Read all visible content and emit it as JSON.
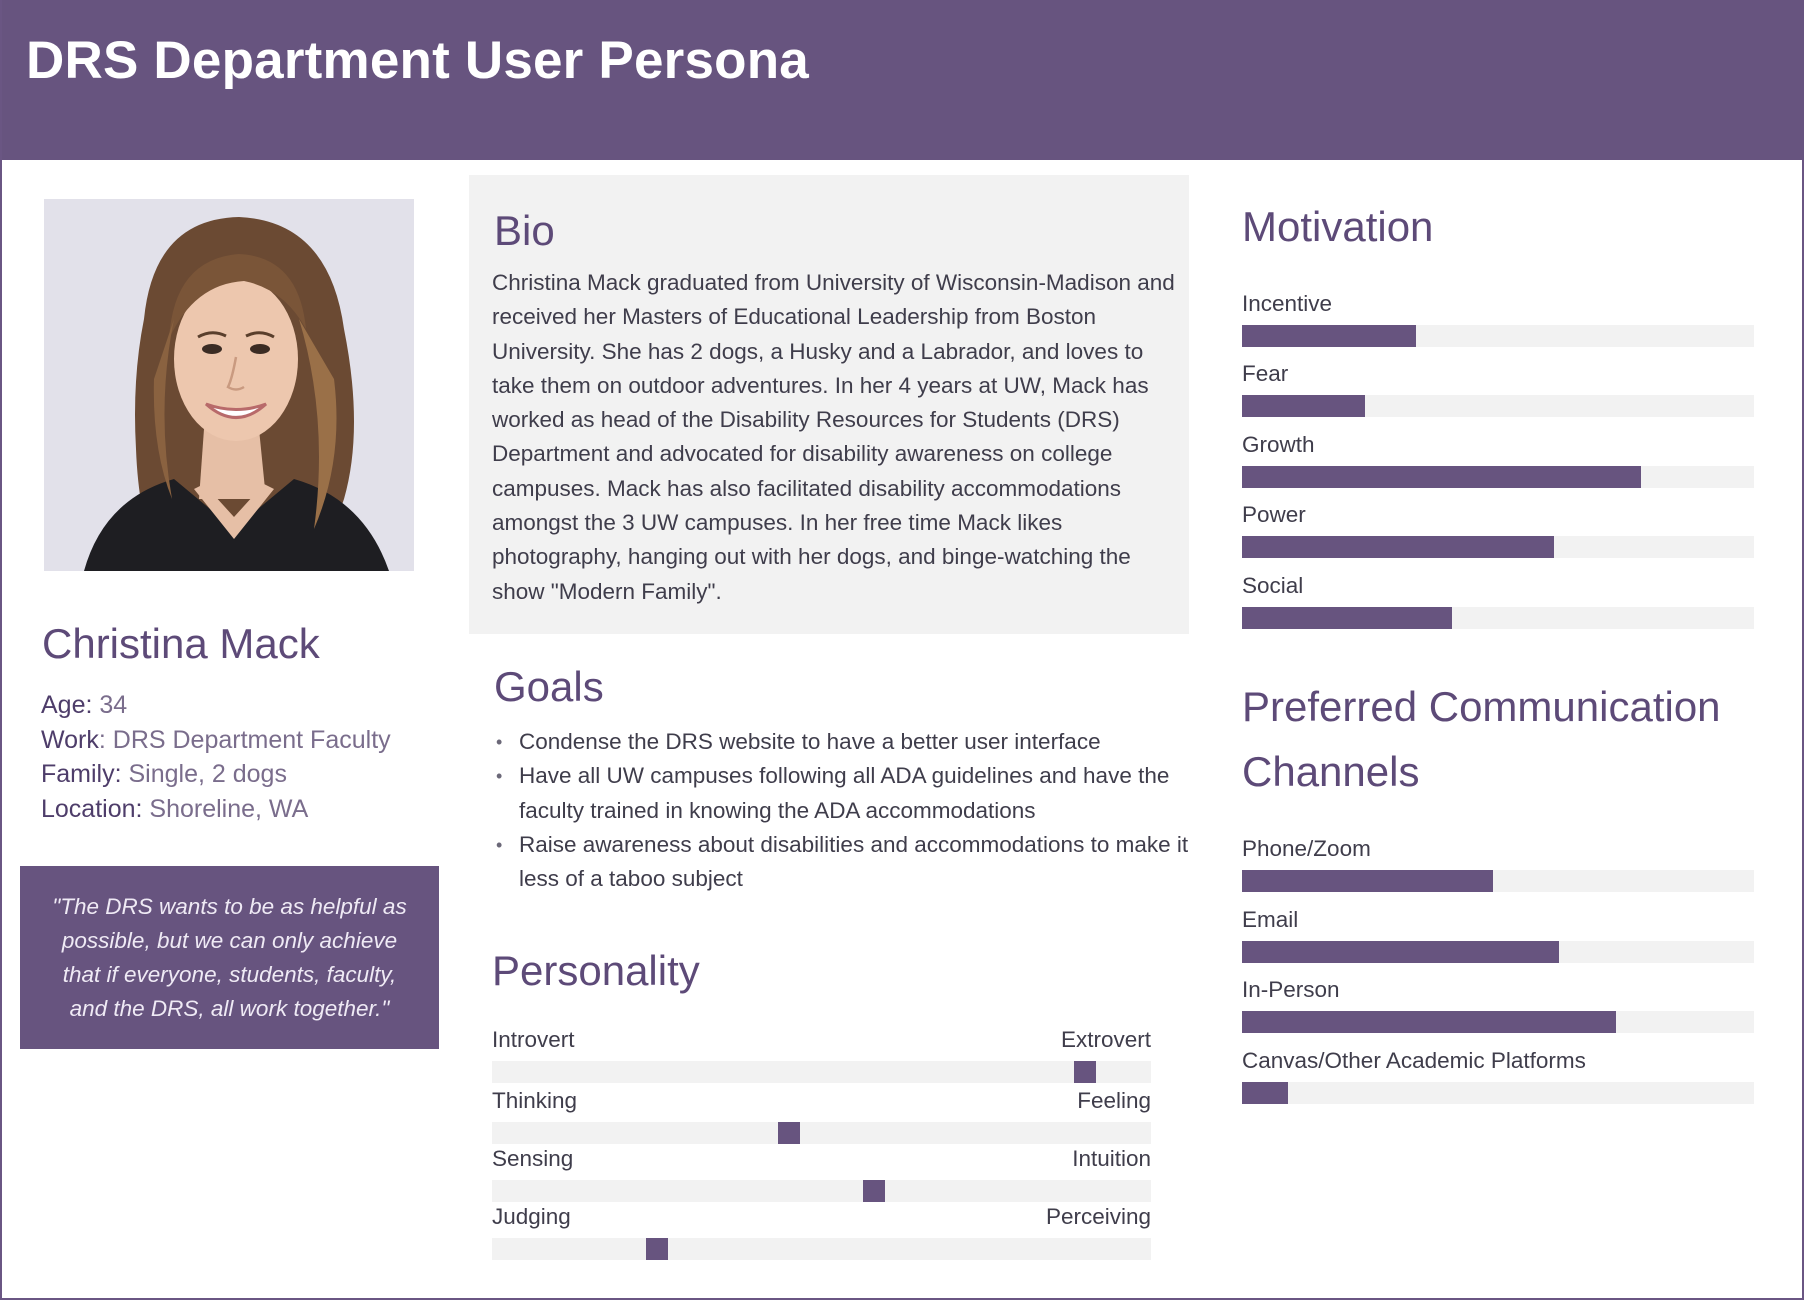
{
  "header": {
    "title": "DRS Department User Persona"
  },
  "persona": {
    "photo_icon": "portrait-photo",
    "name": "Christina Mack",
    "facts": [
      {
        "key": "Age:",
        "value": " 34"
      },
      {
        "key": "Work",
        "value": ": DRS Department Faculty"
      },
      {
        "key": "Family:",
        "value": " Single, 2 dogs"
      },
      {
        "key": "Location:",
        "value": " Shoreline, WA"
      }
    ],
    "quote": "\"The DRS wants to be as helpful as possible, but we can only achieve that if everyone, students, faculty, and the DRS, all work together.\""
  },
  "bio": {
    "title": "Bio",
    "text": "Christina Mack graduated from University of Wisconsin-Madison and received her Masters of Educational Leadership from Boston University. She has 2 dogs, a Husky and a Labrador, and loves to take them on outdoor adventures. In her 4 years at UW, Mack has worked as head of the Disability Resources for Students (DRS) Department and advocated for disability awareness on college campuses. Mack has also facilitated disability accommodations amongst the 3 UW campuses. In her free time Mack likes photography, hanging out with her dogs, and binge-watching the show \"Modern Family\"."
  },
  "goals": {
    "title": "Goals",
    "bullet": "•",
    "items": [
      "Condense the DRS website to have a better user interface",
      "Have all UW campuses following all ADA guidelines and have the faculty trained in knowing the ADA accommodations",
      "Raise awareness about disabilities and accommodations to make it less of a taboo subject"
    ]
  },
  "personality": {
    "title": "Personality",
    "traits": [
      {
        "left": "Introvert",
        "right": "Extrovert",
        "value": 0.9
      },
      {
        "left": "Thinking",
        "right": "Feeling",
        "value": 0.45
      },
      {
        "left": "Sensing",
        "right": "Intuition",
        "value": 0.58
      },
      {
        "left": "Judging",
        "right": "Perceiving",
        "value": 0.25
      }
    ]
  },
  "motivation": {
    "title": "Motivation",
    "items": [
      {
        "label": "Incentive",
        "value": 0.34
      },
      {
        "label": "Fear",
        "value": 0.24
      },
      {
        "label": "Growth",
        "value": 0.78
      },
      {
        "label": "Power",
        "value": 0.61
      },
      {
        "label": "Social",
        "value": 0.41
      }
    ]
  },
  "channels": {
    "title_line1": "Preferred Communication",
    "title_line2": "Channels",
    "items": [
      {
        "label": "Phone/Zoom",
        "value": 0.49
      },
      {
        "label": "Email",
        "value": 0.62
      },
      {
        "label": "In-Person",
        "value": 0.73
      },
      {
        "label": "Canvas/Other Academic Platforms",
        "value": 0.09
      }
    ]
  },
  "colors": {
    "brand": "#67547f",
    "track": "#f2f2f2",
    "title": "#5d4a78"
  }
}
